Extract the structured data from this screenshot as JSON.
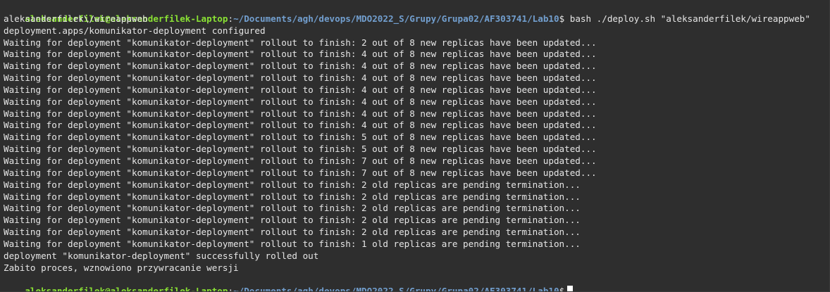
{
  "prompt": {
    "user_host": "aleksanderfilek@aleksanderfilek-Laptop",
    "separator": ":",
    "path": "~/Documents/agh/devops/MDO2022_S/Grupy/Grupa02/AF303741/Lab10",
    "symbol": "$"
  },
  "command": " bash ./deploy.sh \"aleksanderfilek/wireappweb\"",
  "output_lines": [
    "aleksanderfilek\\/wireappweb",
    "deployment.apps/komunikator-deployment configured",
    "Waiting for deployment \"komunikator-deployment\" rollout to finish: 2 out of 8 new replicas have been updated...",
    "Waiting for deployment \"komunikator-deployment\" rollout to finish: 4 out of 8 new replicas have been updated...",
    "Waiting for deployment \"komunikator-deployment\" rollout to finish: 4 out of 8 new replicas have been updated...",
    "Waiting for deployment \"komunikator-deployment\" rollout to finish: 4 out of 8 new replicas have been updated...",
    "Waiting for deployment \"komunikator-deployment\" rollout to finish: 4 out of 8 new replicas have been updated...",
    "Waiting for deployment \"komunikator-deployment\" rollout to finish: 4 out of 8 new replicas have been updated...",
    "Waiting for deployment \"komunikator-deployment\" rollout to finish: 4 out of 8 new replicas have been updated...",
    "Waiting for deployment \"komunikator-deployment\" rollout to finish: 4 out of 8 new replicas have been updated...",
    "Waiting for deployment \"komunikator-deployment\" rollout to finish: 5 out of 8 new replicas have been updated...",
    "Waiting for deployment \"komunikator-deployment\" rollout to finish: 5 out of 8 new replicas have been updated...",
    "Waiting for deployment \"komunikator-deployment\" rollout to finish: 7 out of 8 new replicas have been updated...",
    "Waiting for deployment \"komunikator-deployment\" rollout to finish: 7 out of 8 new replicas have been updated...",
    "Waiting for deployment \"komunikator-deployment\" rollout to finish: 2 old replicas are pending termination...",
    "Waiting for deployment \"komunikator-deployment\" rollout to finish: 2 old replicas are pending termination...",
    "Waiting for deployment \"komunikator-deployment\" rollout to finish: 2 old replicas are pending termination...",
    "Waiting for deployment \"komunikator-deployment\" rollout to finish: 2 old replicas are pending termination...",
    "Waiting for deployment \"komunikator-deployment\" rollout to finish: 2 old replicas are pending termination...",
    "Waiting for deployment \"komunikator-deployment\" rollout to finish: 1 old replicas are pending termination...",
    "deployment \"komunikator-deployment\" successfully rolled out",
    "Zabito proces, wznowiono przywracanie wersji"
  ],
  "colors": {
    "background": "#2e2e2e",
    "text": "#e6e6e6",
    "prompt_user": "#8ae234",
    "prompt_path": "#729fcf"
  }
}
